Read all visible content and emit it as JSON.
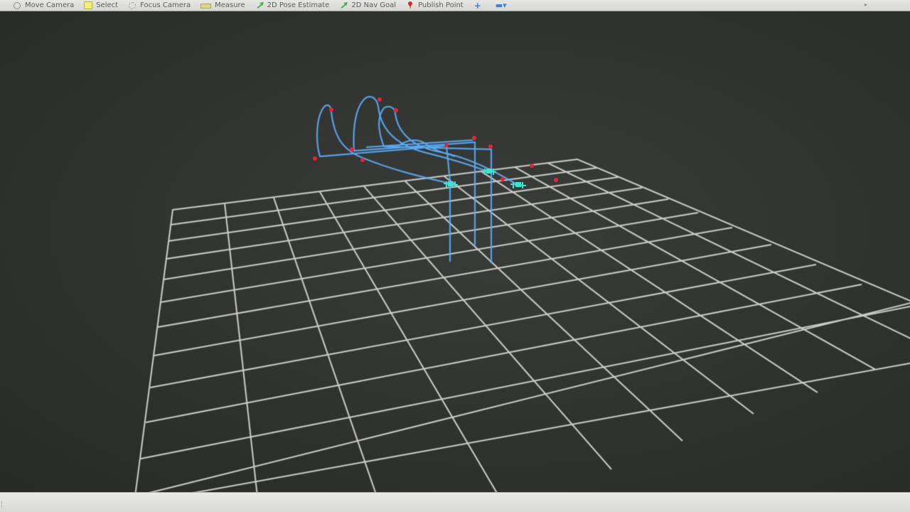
{
  "toolbar": {
    "tools": [
      {
        "label": "Move Camera"
      },
      {
        "label": "Select"
      },
      {
        "label": "Focus Camera"
      },
      {
        "label": "Measure"
      },
      {
        "label": "2D Pose Estimate"
      },
      {
        "label": "2D Nav Goal"
      },
      {
        "label": "Publish Point"
      }
    ],
    "add_tool_icon": "plus-icon",
    "remove_tool_icon": "minus-dropdown-icon"
  },
  "viewport": {
    "grid_color": "#e6e6e6",
    "trajectory_color": "#4fa3f0",
    "waypoint_color": "#e02a3a",
    "robot_color": "#3fe0d0"
  },
  "status": {
    "text": ""
  }
}
